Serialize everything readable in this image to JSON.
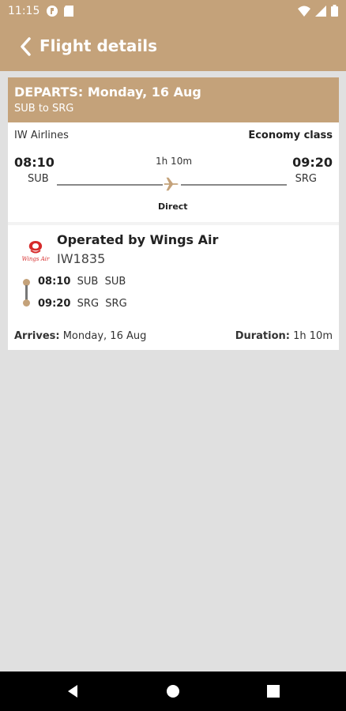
{
  "status": {
    "time": "11:15"
  },
  "appbar": {
    "title": "Flight details"
  },
  "header": {
    "departs_label": "DEPARTS:",
    "departs_date": "Monday, 16 Aug",
    "route": "SUB to SRG"
  },
  "flight": {
    "airline": "IW Airlines",
    "class": "Economy class",
    "dep_time": "08:10",
    "dep_code": "SUB",
    "arr_time": "09:20",
    "arr_code": "SRG",
    "duration": "1h 10m",
    "stops": "Direct"
  },
  "segment": {
    "operated_by": "Operated by Wings Air",
    "flight_number": "IW1835",
    "logo_text": "Wings Air",
    "rows": [
      {
        "time": "08:10",
        "code": "SUB",
        "name": "SUB"
      },
      {
        "time": "09:20",
        "code": "SRG",
        "name": "SRG"
      }
    ]
  },
  "footer": {
    "arrives_label": "Arrives:",
    "arrives_value": "Monday, 16 Aug",
    "duration_label": "Duration:",
    "duration_value": "1h 10m"
  },
  "colors": {
    "accent": "#c4a27a",
    "logo_red": "#d62b2b"
  },
  "icons": [
    "back-arrow-icon",
    "airplane-icon",
    "wifi-icon",
    "signal-icon",
    "battery-icon",
    "nav-back-icon",
    "nav-home-icon",
    "nav-recents-icon"
  ]
}
